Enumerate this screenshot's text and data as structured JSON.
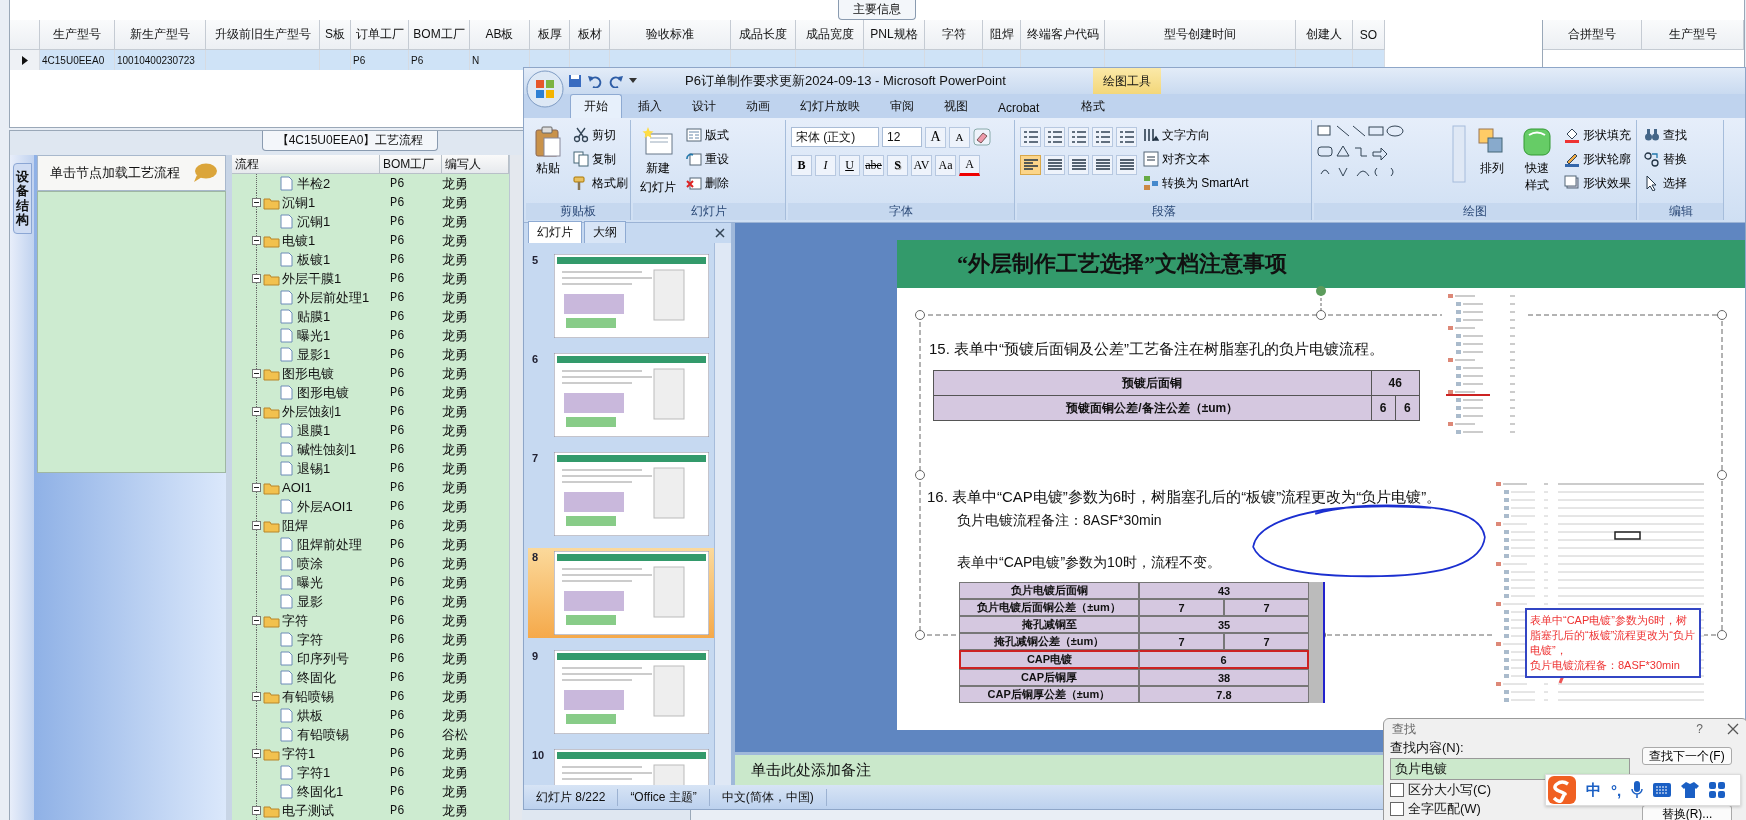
{
  "main_info": {
    "title": "主要信息",
    "columns": [
      "生产型号",
      "新生产型号",
      "升级前旧生产型号",
      "S板",
      "订单工厂",
      "BOM工厂",
      "AB板",
      "板厚",
      "板材",
      "验收标准",
      "成品长度",
      "成品宽度",
      "PNL规格",
      "字符",
      "阻焊",
      "终端客户代码",
      "型号创建时间",
      "创建人",
      "SO"
    ],
    "rows": [
      {
        "selected": true,
        "cells": [
          "4C15U0EEA0",
          "10010400230723",
          null,
          null,
          "P6",
          "P6",
          "N"
        ]
      }
    ],
    "merge_columns": [
      "合拼型号",
      "生产型号"
    ]
  },
  "process_panel": {
    "title": "【4C15U0EEA0】工艺流程",
    "side_tab": "设备结构",
    "hint": "单击节点加载工艺流程",
    "tree": {
      "columns": [
        "流程",
        "BOM工厂",
        "编写人"
      ],
      "items": [
        {
          "kind": "file",
          "label": "半检2",
          "bom": "P6",
          "author": "龙勇"
        },
        {
          "kind": "folder",
          "label": "沉铜1",
          "bom": "P6",
          "author": "龙勇",
          "expanded": true,
          "children": [
            {
              "kind": "file",
              "label": "沉铜1",
              "bom": "P6",
              "author": "龙勇"
            }
          ]
        },
        {
          "kind": "folder",
          "label": "电镀1",
          "bom": "P6",
          "author": "龙勇",
          "expanded": true,
          "children": [
            {
              "kind": "file",
              "label": "板镀1",
              "bom": "P6",
              "author": "龙勇"
            }
          ]
        },
        {
          "kind": "folder",
          "label": "外层干膜1",
          "bom": "P6",
          "author": "龙勇",
          "expanded": true,
          "children": [
            {
              "kind": "file",
              "label": "外层前处理1",
              "bom": "P6",
              "author": "龙勇"
            },
            {
              "kind": "file",
              "label": "贴膜1",
              "bom": "P6",
              "author": "龙勇"
            },
            {
              "kind": "file",
              "label": "曝光1",
              "bom": "P6",
              "author": "龙勇"
            },
            {
              "kind": "file",
              "label": "显影1",
              "bom": "P6",
              "author": "龙勇"
            }
          ]
        },
        {
          "kind": "folder",
          "label": "图形电镀",
          "bom": "P6",
          "author": "龙勇",
          "expanded": true,
          "children": [
            {
              "kind": "file",
              "label": "图形电镀",
              "bom": "P6",
              "author": "龙勇"
            }
          ]
        },
        {
          "kind": "folder",
          "label": "外层蚀刻1",
          "bom": "P6",
          "author": "龙勇",
          "expanded": true,
          "children": [
            {
              "kind": "file",
              "label": "退膜1",
              "bom": "P6",
              "author": "龙勇"
            },
            {
              "kind": "file",
              "label": "碱性蚀刻1",
              "bom": "P6",
              "author": "龙勇"
            },
            {
              "kind": "file",
              "label": "退锡1",
              "bom": "P6",
              "author": "龙勇"
            }
          ]
        },
        {
          "kind": "folder",
          "label": "AOI1",
          "bom": "P6",
          "author": "龙勇",
          "expanded": true,
          "children": [
            {
              "kind": "file",
              "label": "外层AOI1",
              "bom": "P6",
              "author": "龙勇"
            }
          ]
        },
        {
          "kind": "folder",
          "label": "阻焊",
          "bom": "P6",
          "author": "龙勇",
          "expanded": true,
          "children": [
            {
              "kind": "file",
              "label": "阻焊前处理",
              "bom": "P6",
              "author": "龙勇"
            },
            {
              "kind": "file",
              "label": "喷涂",
              "bom": "P6",
              "author": "龙勇"
            },
            {
              "kind": "file",
              "label": "曝光",
              "bom": "P6",
              "author": "龙勇"
            },
            {
              "kind": "file",
              "label": "显影",
              "bom": "P6",
              "author": "龙勇"
            }
          ]
        },
        {
          "kind": "folder",
          "label": "字符",
          "bom": "P6",
          "author": "龙勇",
          "expanded": true,
          "children": [
            {
              "kind": "file",
              "label": "字符",
              "bom": "P6",
              "author": "龙勇"
            },
            {
              "kind": "file",
              "label": "印序列号",
              "bom": "P6",
              "author": "龙勇"
            },
            {
              "kind": "file",
              "label": "终固化",
              "bom": "P6",
              "author": "龙勇"
            }
          ]
        },
        {
          "kind": "folder",
          "label": "有铅喷锡",
          "bom": "P6",
          "author": "龙勇",
          "expanded": true,
          "children": [
            {
              "kind": "file",
              "label": "烘板",
              "bom": "P6",
              "author": "龙勇"
            },
            {
              "kind": "file",
              "label": "有铅喷锡",
              "bom": "P6",
              "author": "谷松"
            }
          ]
        },
        {
          "kind": "folder",
          "label": "字符1",
          "bom": "P6",
          "author": "龙勇",
          "expanded": true,
          "children": [
            {
              "kind": "file",
              "label": "字符1",
              "bom": "P6",
              "author": "龙勇"
            },
            {
              "kind": "file",
              "label": "终固化1",
              "bom": "P6",
              "author": "龙勇"
            }
          ]
        },
        {
          "kind": "folder",
          "label": "电子测试",
          "bom": "P6",
          "author": "龙勇",
          "expanded": true
        }
      ]
    }
  },
  "ppt": {
    "title": "P6订单制作要求更新2024-09-13 - Microsoft PowerPoint",
    "context_tab": "绘图工具",
    "tabs": [
      {
        "label": "开始",
        "selected": true
      },
      {
        "label": "插入",
        "selected": false
      },
      {
        "label": "设计",
        "selected": false
      },
      {
        "label": "动画",
        "selected": false
      },
      {
        "label": "幻灯片放映",
        "selected": false
      },
      {
        "label": "审阅",
        "selected": false
      },
      {
        "label": "视图",
        "selected": false
      },
      {
        "label": "Acrobat",
        "selected": false
      },
      {
        "label": "格式",
        "selected": false
      }
    ],
    "ribbon": [
      {
        "kind": "commands",
        "label": "剪贴板",
        "large": [
          "粘贴"
        ],
        "small": [
          "剪切",
          "复制",
          "格式刷"
        ]
      },
      {
        "kind": "commands",
        "label": "幻灯片",
        "large": [
          [
            "新建",
            "幻灯片"
          ]
        ],
        "small": [
          "版式",
          "重设",
          "删除"
        ]
      },
      {
        "kind": "font",
        "label": "字体",
        "font": "宋体 (正文)",
        "size": "12",
        "size_buttons": [
          "A",
          "A"
        ],
        "format_buttons": [
          "B",
          "I",
          "U",
          "abe",
          "S",
          "AV",
          "Aa",
          "A"
        ]
      },
      {
        "kind": "paragraph",
        "label": "段落",
        "alignment_buttons": [
          {
            "selected": true
          },
          {
            "selected": false
          },
          {
            "selected": false
          },
          {
            "selected": false
          },
          {
            "selected": false
          }
        ],
        "small": [
          "文字方向",
          "对齐文本",
          "转换为 SmartArt"
        ]
      },
      {
        "kind": "drawing",
        "label": "绘图",
        "large": [
          "排列",
          "快速样式"
        ],
        "small": [
          "形状填充",
          "形状轮廓",
          "形状效果"
        ]
      },
      {
        "kind": "commands",
        "label": "编辑",
        "small": [
          "查找",
          "替换",
          "选择"
        ]
      }
    ],
    "slide_pane": {
      "tabs": [
        {
          "label": "幻灯片",
          "selected": true
        },
        {
          "label": "大纲",
          "selected": false
        }
      ],
      "thumbnails": [
        {
          "number": "5",
          "selected": false
        },
        {
          "number": "6",
          "selected": false
        },
        {
          "number": "7",
          "selected": false
        },
        {
          "number": "8",
          "selected": true
        },
        {
          "number": "9",
          "selected": false
        },
        {
          "number": "10",
          "selected": false
        }
      ]
    },
    "slide": {
      "title": "“外层制作工艺选择”文档注意事项",
      "item_15": {
        "number": "15.",
        "text": "表单中“预镀后面铜及公差”工艺备注在树脂塞孔的负片电镀流程。"
      },
      "table_1": [
        {
          "cells": [
            "预镀后面铜",
            "46"
          ]
        },
        {
          "cells": [
            "预镀面铜公差/备注公差（±um）",
            "6",
            "6"
          ]
        }
      ],
      "item_16": {
        "number": "16.",
        "text": "表单中“CAP电镀”参数为6时，树脂塞孔后的“板镀”流程更改为“负片电镀”。",
        "note": "负片电镀流程备注：8ASF*30min",
        "extra": "表单中“CAP电镀”参数为10时，流程不变。"
      },
      "table_2": [
        {
          "cells": [
            "负片电镀后面铜",
            "43"
          ],
          "highlighted": false
        },
        {
          "cells": [
            "负片电镀后面铜公差（±um）",
            "7",
            "7"
          ],
          "highlighted": false
        },
        {
          "cells": [
            "掩孔减铜至",
            "35"
          ],
          "highlighted": false
        },
        {
          "cells": [
            "掩孔减铜公差（±um）",
            "7",
            "7"
          ],
          "highlighted": false
        },
        {
          "cells": [
            "CAP电镀",
            "6"
          ],
          "highlighted": true
        },
        {
          "cells": [
            "CAP后铜厚",
            "38"
          ],
          "highlighted": false
        },
        {
          "cells": [
            "CAP后铜厚公差（±um）",
            "7.8"
          ],
          "highlighted": false
        }
      ],
      "callout": [
        "表单中“CAP电镀”参数为6时，树脂塞孔后的“板镀”流程更改为“负片电镀”，",
        "负片电镀流程备：8ASF*30min"
      ]
    },
    "notes_placeholder": "单击此处添加备注",
    "status_bar": [
      "幻灯片 8/222",
      "“Office 主题”",
      "中文(简体，中国)"
    ]
  },
  "find_dialog": {
    "title": "查找",
    "help": "?",
    "field_label": "查找内容(N):",
    "value": "负片电镀",
    "options": [
      {
        "label": "区分大小写(C)",
        "checked": false
      },
      {
        "label": "全字匹配(W)",
        "checked": false
      }
    ],
    "buttons": [
      "查找下一个(F)",
      "替换(R)..."
    ]
  },
  "ime_bar": {
    "mode": "中",
    "punctuation": "°,"
  }
}
